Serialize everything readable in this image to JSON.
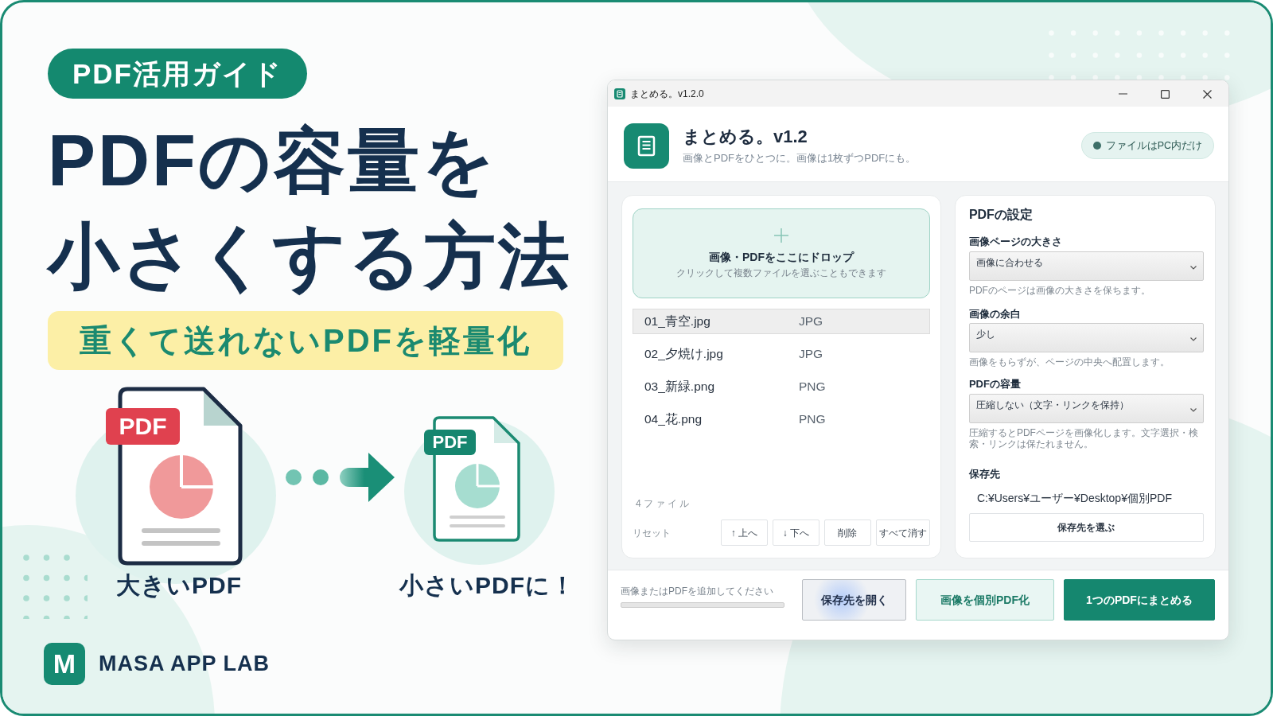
{
  "guide_badge": "PDF活用ガイド",
  "headline_lines": [
    "PDFの容量を",
    "小さくする方法"
  ],
  "tagline": "重くて送れないPDFを軽量化",
  "illustration": {
    "before": {
      "tag": "PDF",
      "caption": "大きいPDF"
    },
    "after": {
      "tag": "PDF",
      "caption": "小さいPDFに！"
    }
  },
  "brand": {
    "logo_letter": "M",
    "name": "MASA APP LAB"
  },
  "app_window": {
    "title": "まとめる。v1.2.0",
    "header": {
      "title": "まとめる。v1.2",
      "subtitle": "画像とPDFをひとつに。画像は1枚ずつPDFにも。",
      "badge": "ファイルはPC内だけ"
    },
    "drop_zone": {
      "title": "画像・PDFをここにドロップ",
      "hint": "クリックして複数ファイルを選ぶこともできます"
    },
    "files": [
      {
        "name": "01_青空.jpg",
        "type": "JPG",
        "selected": true
      },
      {
        "name": "02_夕焼け.jpg",
        "type": "JPG",
        "selected": false
      },
      {
        "name": "03_新緑.png",
        "type": "PNG",
        "selected": false
      },
      {
        "name": "04_花.png",
        "type": "PNG",
        "selected": false
      }
    ],
    "file_count": "4ファイル",
    "reset_link": "リセット",
    "list_buttons": [
      "↑ 上へ",
      "↓ 下へ",
      "削除",
      "すべて消す"
    ],
    "settings": {
      "title": "PDFの設定",
      "fields": [
        {
          "label": "画像ページの大きさ",
          "value": "画像に合わせる",
          "hint": "PDFのページは画像の大きさを保ちます。"
        },
        {
          "label": "画像の余白",
          "value": "少し",
          "hint": "画像をもらずが、ページの中央へ配置します。"
        },
        {
          "label": "PDFの容量",
          "value": "圧縮しない（文字・リンクを保持）",
          "hint": "圧縮するとPDFページを画像化します。文字選択・検索・リンクは保たれません。"
        }
      ],
      "destination": {
        "label": "保存先",
        "path": "C:¥Users¥ユーザー¥Desktop¥個別PDF",
        "button": "保存先を選ぶ"
      }
    },
    "footer": {
      "status": "画像またはPDFを追加してください",
      "progress": {
        "level": 0
      },
      "buttons": [
        {
          "label": "保存先を開く",
          "kind": "secondary",
          "focused": true
        },
        {
          "label": "画像を個別PDF化",
          "kind": "outline",
          "focused": false
        },
        {
          "label": "1つのPDFにまとめる",
          "kind": "primary",
          "focused": false
        }
      ]
    }
  }
}
